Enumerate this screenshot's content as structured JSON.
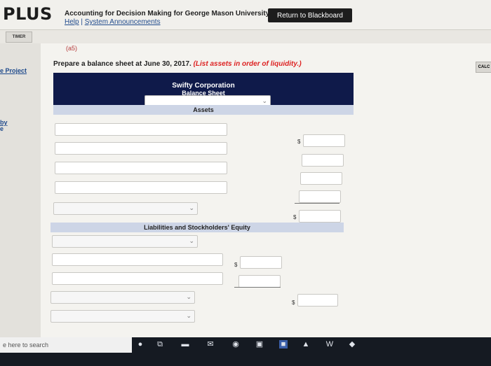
{
  "header": {
    "logo": "PLUS",
    "course_title": "Accounting for Decision Making for George Mason University, 1e",
    "help_link": "Help",
    "separator": " | ",
    "announcements_link": "System Announcements",
    "return_button": "Return to Blackboard"
  },
  "tabs": {
    "timer": "TIMER",
    "calculator": "CALC"
  },
  "left_nav": {
    "project_link": "e Project",
    "by_link": "by",
    "fragment": "e"
  },
  "question": {
    "prev_label": "(a5)",
    "instruction_text": "Prepare a balance sheet at June 30, 2017. ",
    "instruction_note": "(List assets in order of liquidity.)"
  },
  "balance_sheet": {
    "company": "Swifty Corporation",
    "title": "Balance Sheet",
    "date_selected": "",
    "assets_heading": "Assets",
    "liabilities_heading": "Liabilities and Stockholders' Equity",
    "currency_symbol": "$"
  },
  "taskbar": {
    "search_placeholder": "e here to search"
  },
  "icons": {
    "chevron": "⌄",
    "mic": "●",
    "task_view": "⧉",
    "folder": "▬",
    "mail": "✉",
    "chat": "◉",
    "store": "▣",
    "app": "■",
    "pdf": "▲",
    "word": "W",
    "browser": "◆"
  }
}
